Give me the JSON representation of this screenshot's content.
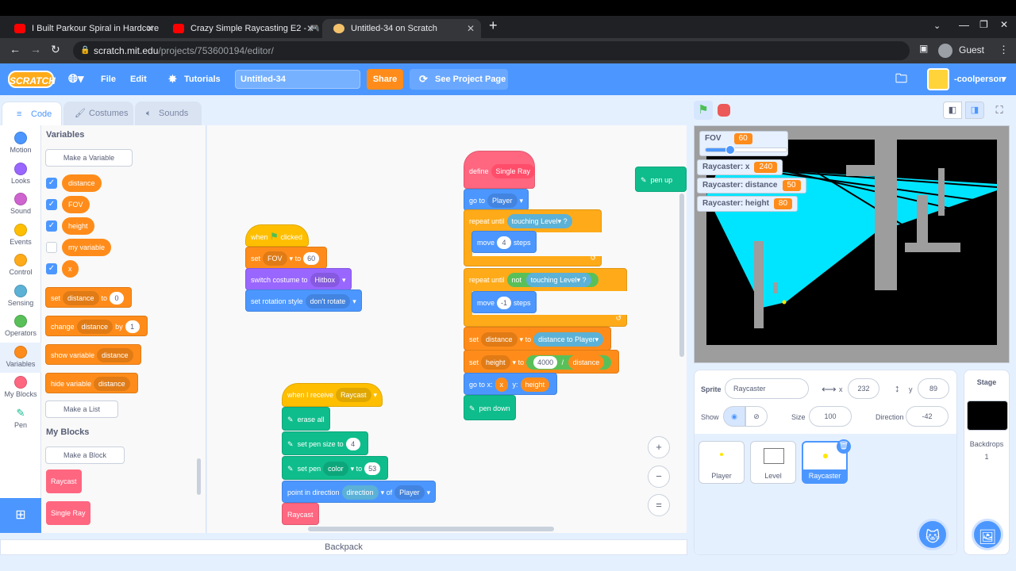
{
  "browser": {
    "tabs": [
      {
        "title": "I Built Parkour Spiral in Hardcore",
        "icon_color": "#ff0000"
      },
      {
        "title": "Crazy Simple Raycasting E2 - 🎮",
        "icon_color": "#ff0000"
      },
      {
        "title": "Untitled-34 on Scratch",
        "icon_color": "#f3c26b"
      }
    ],
    "new_tab": "+",
    "url_host": "scratch.mit.edu",
    "url_path": "/projects/753600194/editor/",
    "profile": "Guest"
  },
  "menubar": {
    "logo": "SCRATCH",
    "file": "File",
    "edit": "Edit",
    "tutorials": "Tutorials",
    "project_title": "Untitled-34",
    "share": "Share",
    "see_project": "See Project Page",
    "username": "-coolperson"
  },
  "tabs": {
    "code": "Code",
    "costumes": "Costumes",
    "sounds": "Sounds"
  },
  "categories": [
    {
      "label": "Motion",
      "color": "#4c97ff"
    },
    {
      "label": "Looks",
      "color": "#9966ff"
    },
    {
      "label": "Sound",
      "color": "#cf63cf"
    },
    {
      "label": "Events",
      "color": "#ffbf00"
    },
    {
      "label": "Control",
      "color": "#ffab19"
    },
    {
      "label": "Sensing",
      "color": "#5cb1d6"
    },
    {
      "label": "Operators",
      "color": "#59c059"
    },
    {
      "label": "Variables",
      "color": "#ff8c1a"
    },
    {
      "label": "My Blocks",
      "color": "#ff6680"
    },
    {
      "label": "Pen",
      "color": "#0fbd8c"
    }
  ],
  "palette": {
    "variables_heading": "Variables",
    "make_variable": "Make a Variable",
    "variables": [
      {
        "name": "distance",
        "checked": true
      },
      {
        "name": "FOV",
        "checked": true
      },
      {
        "name": "height",
        "checked": true
      },
      {
        "name": "my variable",
        "checked": false
      },
      {
        "name": "x",
        "checked": true
      }
    ],
    "set_block": {
      "label": "set",
      "var": "distance",
      "to": "to",
      "value": "0"
    },
    "change_block": {
      "label": "change",
      "var": "distance",
      "by": "by",
      "value": "1"
    },
    "show_block": {
      "label": "show variable",
      "var": "distance"
    },
    "hide_block": {
      "label": "hide variable",
      "var": "distance"
    },
    "make_list": "Make a List",
    "myblocks_heading": "My Blocks",
    "make_block": "Make a Block",
    "custom_blocks": [
      "Raycast",
      "Single Ray"
    ]
  },
  "script1": {
    "hat": "when",
    "hat2": "clicked",
    "set": "set",
    "set_var": "FOV",
    "to": "to",
    "set_val": "60",
    "costume": "switch costume to",
    "costume_val": "Hitbox",
    "rotation": "set rotation style",
    "rotation_val": "don't rotate"
  },
  "script2": {
    "hat": "when I receive",
    "hat_msg": "Raycast",
    "erase": "erase all",
    "pensize": "set pen size to",
    "pensize_val": "4",
    "setpen": "set pen",
    "setpen_prop": "color",
    "to": "to",
    "setpen_val": "53",
    "point": "point in direction",
    "point_prop": "direction",
    "of": "of",
    "point_obj": "Player",
    "call": "Raycast"
  },
  "script3": {
    "define": "define",
    "define_name": "Single Ray",
    "goto": "go to",
    "goto_val": "Player",
    "repeat1": "repeat until",
    "touching": "touching",
    "touching_val": "Level",
    "q": "?",
    "move1": "move",
    "move1_val": "4",
    "steps": "steps",
    "repeat2": "repeat until",
    "not": "not",
    "move2_val": "-1",
    "set1": "set",
    "set1_var": "distance",
    "to": "to",
    "dist_to": "distance to",
    "dist_obj": "Player",
    "set2_var": "height",
    "set2_val": "4000",
    "div": "/",
    "set2_div": "distance",
    "gotoxy": "go to x:",
    "gx": "x",
    "y": "y:",
    "gy": "height",
    "pendown": "pen down"
  },
  "script4": {
    "penup": "pen up"
  },
  "zoom": {
    "in": "+",
    "out": "−",
    "reset": "="
  },
  "backpack": "Backpack",
  "monitors": [
    {
      "label": "FOV",
      "value": "60"
    },
    {
      "label": "Raycaster: x",
      "value": "240"
    },
    {
      "label": "Raycaster: distance",
      "value": "50"
    },
    {
      "label": "Raycaster: height",
      "value": "80"
    }
  ],
  "fov_slider_fraction": 0.3,
  "sprite_info": {
    "sprite_label": "Sprite",
    "sprite_name": "Raycaster",
    "x_label": "x",
    "x": "232",
    "y_label": "y",
    "y": "89",
    "show_label": "Show",
    "size_label": "Size",
    "size": "100",
    "direction_label": "Direction",
    "direction": "-42"
  },
  "sprites": [
    "Player",
    "Level",
    "Raycaster"
  ],
  "stage_pane": {
    "title": "Stage",
    "backdrops_label": "Backdrops",
    "backdrops_count": "1"
  }
}
